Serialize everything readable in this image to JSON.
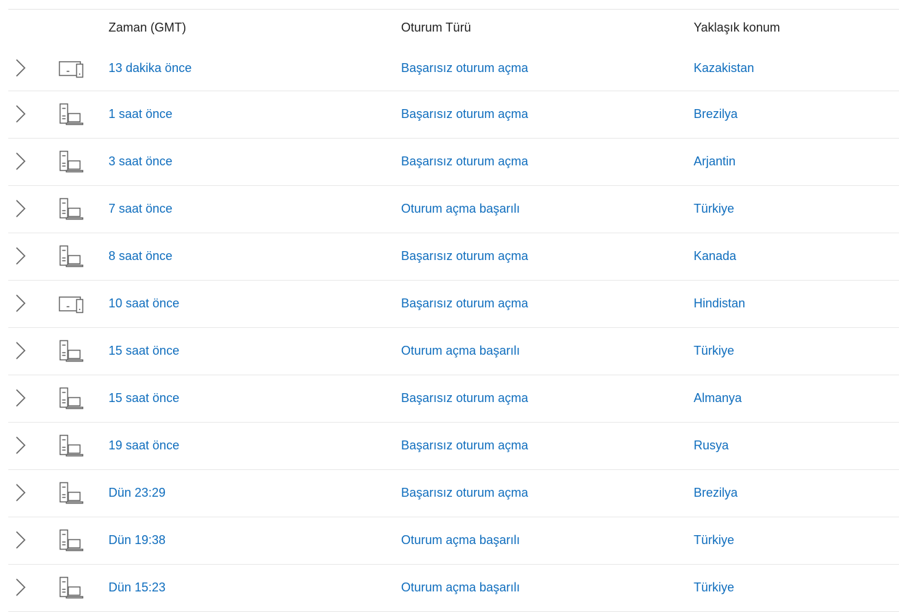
{
  "columns": {
    "time": "Zaman (GMT)",
    "session_type": "Oturum Türü",
    "location": "Yaklaşık konum"
  },
  "rows": [
    {
      "device": "tablet-phone-icon",
      "time": "13 dakika önce",
      "session_type": "Başarısız oturum açma",
      "location": "Kazakistan"
    },
    {
      "device": "desktop-laptop-icon",
      "time": "1 saat önce",
      "session_type": "Başarısız oturum açma",
      "location": "Brezilya"
    },
    {
      "device": "desktop-laptop-icon",
      "time": "3 saat önce",
      "session_type": "Başarısız oturum açma",
      "location": "Arjantin"
    },
    {
      "device": "desktop-laptop-icon",
      "time": "7 saat önce",
      "session_type": "Oturum açma başarılı",
      "location": "Türkiye"
    },
    {
      "device": "desktop-laptop-icon",
      "time": "8 saat önce",
      "session_type": "Başarısız oturum açma",
      "location": "Kanada"
    },
    {
      "device": "tablet-phone-icon",
      "time": "10 saat önce",
      "session_type": "Başarısız oturum açma",
      "location": "Hindistan"
    },
    {
      "device": "desktop-laptop-icon",
      "time": "15 saat önce",
      "session_type": "Oturum açma başarılı",
      "location": "Türkiye"
    },
    {
      "device": "desktop-laptop-icon",
      "time": "15 saat önce",
      "session_type": "Başarısız oturum açma",
      "location": "Almanya"
    },
    {
      "device": "desktop-laptop-icon",
      "time": "19 saat önce",
      "session_type": "Başarısız oturum açma",
      "location": "Rusya"
    },
    {
      "device": "desktop-laptop-icon",
      "time": "Dün 23:29",
      "session_type": "Başarısız oturum açma",
      "location": "Brezilya"
    },
    {
      "device": "desktop-laptop-icon",
      "time": "Dün 19:38",
      "session_type": "Oturum açma başarılı",
      "location": "Türkiye"
    },
    {
      "device": "desktop-laptop-icon",
      "time": "Dün 15:23",
      "session_type": "Oturum açma başarılı",
      "location": "Türkiye"
    }
  ],
  "colors": {
    "link": "#106ebe",
    "header_text": "#222222",
    "icon": "#666666",
    "divider": "#e8e8e8"
  }
}
